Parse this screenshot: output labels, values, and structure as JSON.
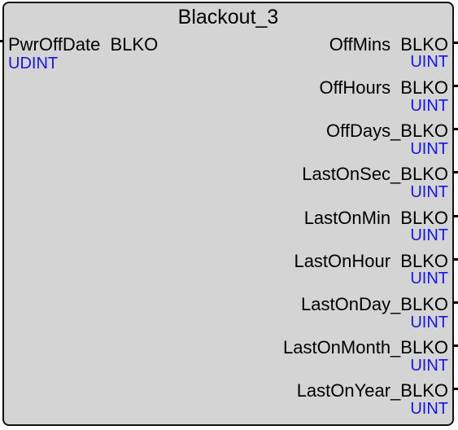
{
  "block": {
    "title": "Blackout_3",
    "inputs": [
      {
        "name": "PwrOffDate  BLKO",
        "type": "UDINT"
      }
    ],
    "outputs": [
      {
        "name": "OffMins  BLKO",
        "type": "UINT"
      },
      {
        "name": "OffHours  BLKO",
        "type": "UINT"
      },
      {
        "name": "OffDays_BLKO",
        "type": "UINT"
      },
      {
        "name": "LastOnSec_BLKO",
        "type": "UINT"
      },
      {
        "name": "LastOnMin  BLKO",
        "type": "UINT"
      },
      {
        "name": "LastOnHour  BLKO",
        "type": "UINT"
      },
      {
        "name": "LastOnDay_BLKO",
        "type": "UINT"
      },
      {
        "name": "LastOnMonth_BLKO",
        "type": "UINT"
      },
      {
        "name": "LastOnYear_BLKO",
        "type": "UINT"
      }
    ]
  },
  "colors": {
    "block_fill": "#d4d4d4",
    "border": "#111111",
    "type_text": "#1616e6"
  }
}
